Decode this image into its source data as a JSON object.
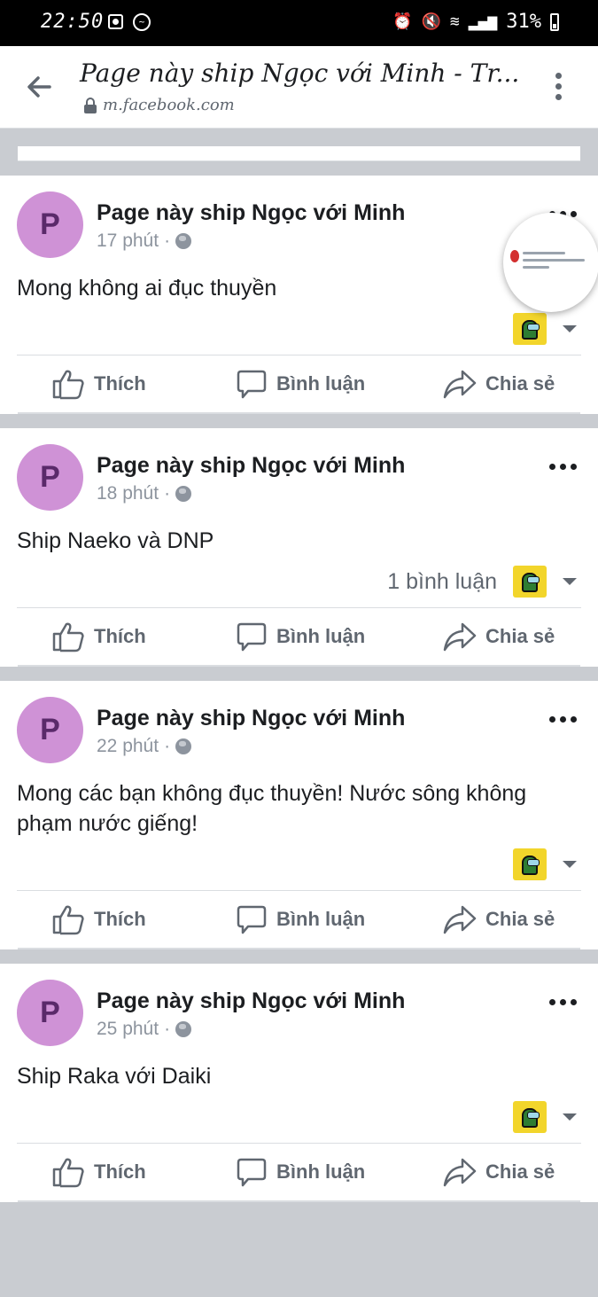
{
  "status_bar": {
    "time": "22:50",
    "battery": "31%"
  },
  "browser": {
    "title": "Page này ship Ngọc với Minh - Tr...",
    "domain": "m.facebook.com"
  },
  "posts": [
    {
      "author": "Page này ship Ngọc với Minh",
      "time": "17 phút",
      "text": "Mong không ai đục thuyền",
      "comments": ""
    },
    {
      "author": "Page này ship Ngọc với Minh",
      "time": "18 phút",
      "text": "Ship Naeko và DNP",
      "comments": "1 bình luận"
    },
    {
      "author": "Page này ship Ngọc với Minh",
      "time": "22 phút",
      "text": "Mong các bạn không đục thuyền! Nước sông không phạm nước giếng!",
      "comments": ""
    },
    {
      "author": "Page này ship Ngọc với Minh",
      "time": "25 phút",
      "text": "Ship Raka với Daiki",
      "comments": ""
    }
  ],
  "avatar_letter": "P",
  "actions": {
    "like": "Thích",
    "comment": "Bình luận",
    "share": "Chia sẻ"
  },
  "icons": [
    "back-arrow-icon",
    "lock-icon",
    "kebab-menu-icon",
    "globe-icon",
    "more-dots-icon",
    "like-icon",
    "comment-icon",
    "share-icon",
    "caret-down-icon"
  ],
  "colors": {
    "avatar_bg": "#cf92d6",
    "text": "#1c1e21",
    "muted": "#606770",
    "feed_bg": "#c9ccd1"
  }
}
